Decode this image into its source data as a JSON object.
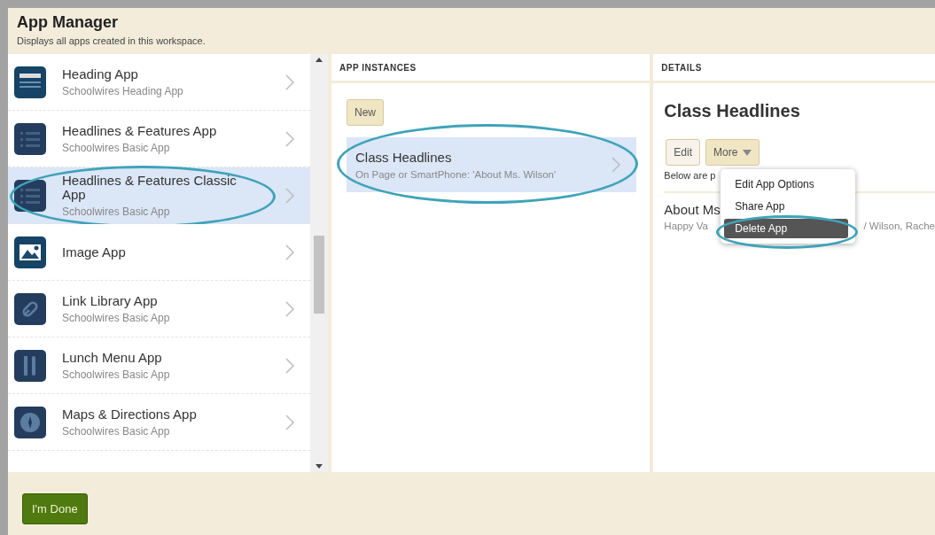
{
  "header": {
    "title": "App Manager",
    "subtitle": "Displays all apps created in this workspace."
  },
  "apps": [
    {
      "name": "Heading App",
      "type": "Schoolwires Heading App",
      "kind": "heading",
      "selected": false
    },
    {
      "name": "Headlines & Features App",
      "type": "Schoolwires Basic App",
      "kind": "list",
      "selected": false
    },
    {
      "name": "Headlines & Features Classic App",
      "type": "Schoolwires Basic App",
      "kind": "list",
      "selected": true
    },
    {
      "name": "Image App",
      "kind": "image",
      "selected": false
    },
    {
      "name": "Link Library App",
      "type": "Schoolwires Basic App",
      "kind": "link",
      "selected": false
    },
    {
      "name": "Lunch Menu App",
      "type": "Schoolwires Basic App",
      "kind": "fork",
      "selected": false
    },
    {
      "name": "Maps & Directions App",
      "type": "Schoolwires Basic App",
      "kind": "compass",
      "selected": false
    }
  ],
  "instances": {
    "heading": "APP INSTANCES",
    "new_button": "New",
    "items": [
      {
        "name": "Class Headlines",
        "location": "On Page or SmartPhone: 'About Ms. Wilson'",
        "selected": true
      }
    ]
  },
  "details": {
    "heading": "DETAILS",
    "title": "Class Headlines",
    "edit_button": "Edit",
    "more_button": "More",
    "note": "Below are p",
    "page_title": "About Ms",
    "page_path_start": "Happy Va",
    "page_path_end": "/ Wilson, Rache",
    "menu": [
      {
        "label": "Edit App Options",
        "selected": false
      },
      {
        "label": "Share App",
        "selected": false
      },
      {
        "label": "Delete App",
        "selected": true
      }
    ]
  },
  "done_button": "I'm Done"
}
